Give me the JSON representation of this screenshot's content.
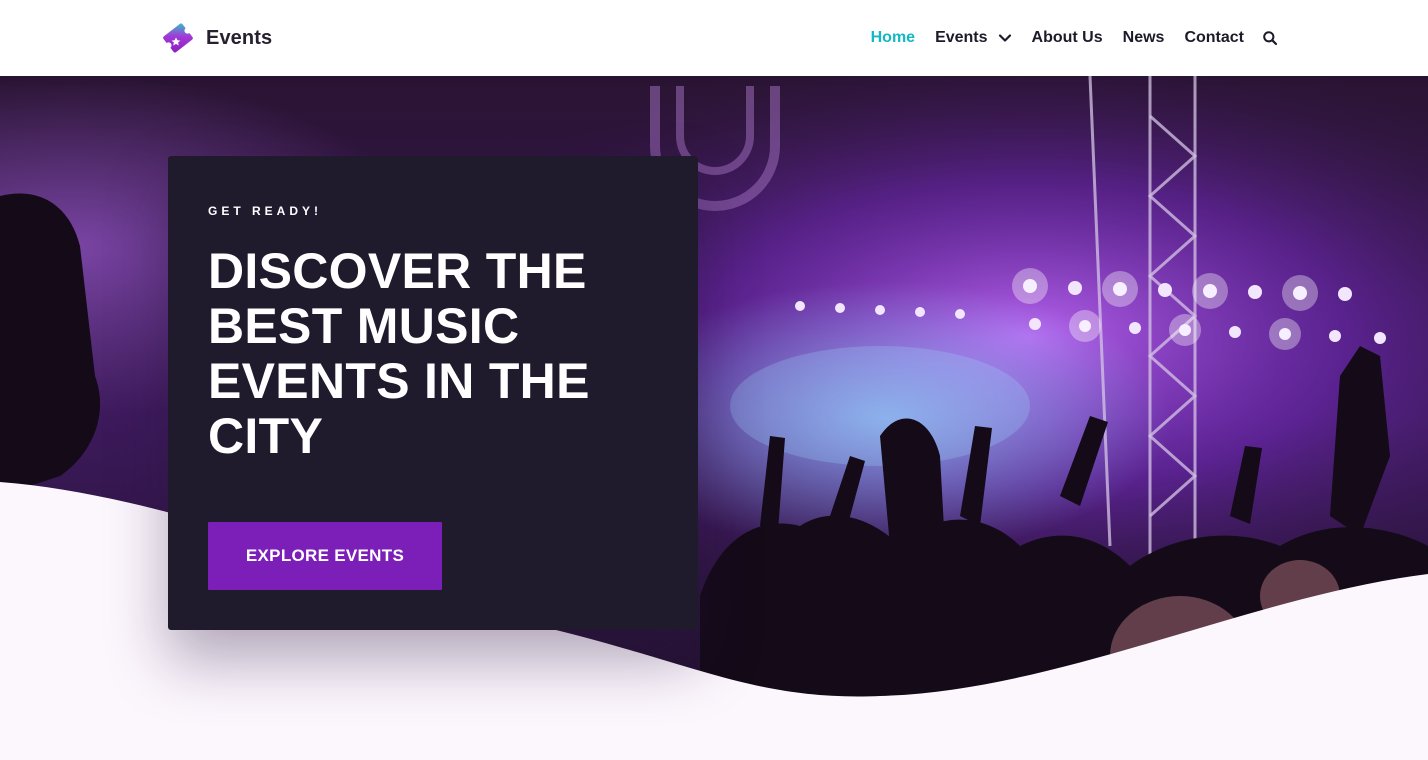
{
  "brand": {
    "name": "Events",
    "logo_icon": "ticket-logo-icon"
  },
  "nav": {
    "items": [
      {
        "label": "Home",
        "active": true
      },
      {
        "label": "Events",
        "has_dropdown": true
      },
      {
        "label": "About Us"
      },
      {
        "label": "News"
      },
      {
        "label": "Contact"
      }
    ],
    "search_icon": "search-icon"
  },
  "hero": {
    "eyebrow": "GET READY!",
    "headline": "DISCOVER THE BEST MUSIC EVENTS IN THE CITY",
    "cta_label": "EXPLORE EVENTS"
  },
  "colors": {
    "accent": "#13b8c3",
    "cta": "#7c1fb8",
    "card": "#201a2d",
    "page_bg": "#fcf6fd"
  }
}
